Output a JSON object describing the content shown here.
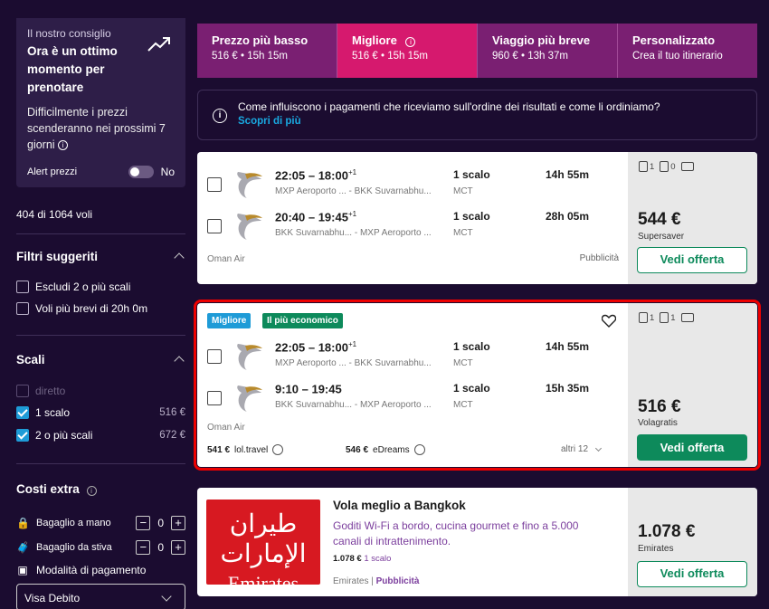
{
  "sidebar": {
    "consiglio": {
      "small": "Il nostro consiglio",
      "headline": "Ora è un ottimo momento per prenotare",
      "desc": "Difficilmente i prezzi scenderanno nei prossimi 7 giorni",
      "alert_label": "Alert prezzi",
      "alert_value": "No"
    },
    "count": "404 di 1064 voli",
    "filtri_title": "Filtri suggeriti",
    "filtri": [
      "Escludi 2 o più scali",
      "Voli più brevi di 20h 0m"
    ],
    "scali_title": "Scali",
    "scali": [
      {
        "label": "diretto",
        "price": ""
      },
      {
        "label": "1 scalo",
        "price": "516 €"
      },
      {
        "label": "2 o più scali",
        "price": "672 €"
      }
    ],
    "costi_title": "Costi extra",
    "bagaglio_mano": {
      "label": "Bagaglio a mano",
      "value": "0"
    },
    "bagaglio_stiva": {
      "label": "Bagaglio da stiva",
      "value": "0"
    },
    "pagamento_label": "Modalità di pagamento",
    "pagamento_value": "Visa Debito"
  },
  "tabs": [
    {
      "title": "Prezzo più basso",
      "sub": "516 € • 15h 15m"
    },
    {
      "title": "Migliore",
      "sub": "516 € • 15h 15m"
    },
    {
      "title": "Viaggio più breve",
      "sub": "960 € • 13h 37m"
    },
    {
      "title": "Personalizzato",
      "sub": "Crea il tuo itinerario"
    }
  ],
  "info": {
    "text": "Come influiscono i pagamenti che riceviamo sull'ordine dei risultati e come li ordiniamo?",
    "link": "Scopri di più"
  },
  "card1": {
    "legs": [
      {
        "times": "22:05 – 18:00",
        "plus": "+1",
        "airports": "MXP Aeroporto ... - BKK Suvarnabhu...",
        "stops": "1 scalo",
        "via": "MCT",
        "dur": "14h 55m"
      },
      {
        "times": "20:40 – 19:45",
        "plus": "+1",
        "airports": "BKK Suvarnabhu... - MXP Aeroporto ...",
        "stops": "1 scalo",
        "via": "MCT",
        "dur": "28h 05m"
      }
    ],
    "airline": "Oman Air",
    "sponsored": "Pubblicità",
    "bags": [
      "1",
      "0"
    ],
    "price": "544 €",
    "provider": "Supersaver",
    "cta": "Vedi offerta"
  },
  "card2": {
    "badges": [
      "Migliore",
      "Il più economico"
    ],
    "legs": [
      {
        "times": "22:05 – 18:00",
        "plus": "+1",
        "airports": "MXP Aeroporto ... - BKK Suvarnabhu...",
        "stops": "1 scalo",
        "via": "MCT",
        "dur": "14h 55m"
      },
      {
        "times": "9:10 – 19:45",
        "plus": "",
        "airports": "BKK Suvarnabhu... - MXP Aeroporto ...",
        "stops": "1 scalo",
        "via": "MCT",
        "dur": "15h 35m"
      }
    ],
    "airline": "Oman Air",
    "others": [
      {
        "price": "541 €",
        "name": "lol.travel"
      },
      {
        "price": "546 €",
        "name": "eDreams"
      }
    ],
    "altri": "altri 12",
    "bags": [
      "1",
      "1"
    ],
    "price": "516 €",
    "provider": "Volagratis",
    "cta": "Vedi offerta"
  },
  "ad": {
    "logo_ar": "طيران الإمارات",
    "logo_en": "Emirates",
    "title": "Vola meglio a Bangkok",
    "desc": "Goditi Wi-Fi a bordo, cucina gourmet e fino a 5.000 canali di intrattenimento.",
    "price_line": "1.078 €",
    "stops": "1 scalo",
    "airline": "Emirates",
    "sponsored": "Pubblicità",
    "price": "1.078 €",
    "provider": "Emirates",
    "cta": "Vedi offerta"
  },
  "colors": {
    "tab_bg": "#7a1f72",
    "tab_active": "#d6196e",
    "cta_green": "#0d8a5b",
    "badge_blue": "#1e9bd7",
    "badge_green": "#0d8a5b",
    "highlight": "#e00000"
  }
}
